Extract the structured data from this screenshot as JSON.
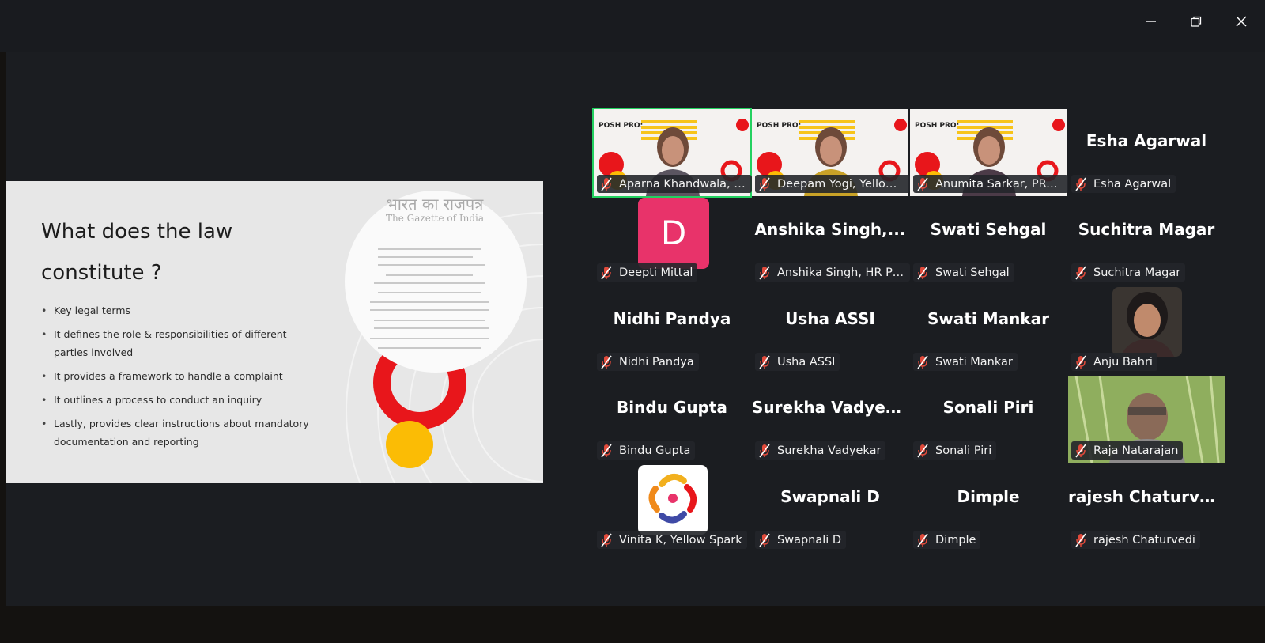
{
  "window": {
    "controls": [
      "minimize-icon",
      "restore-icon",
      "close-icon"
    ]
  },
  "slide": {
    "title_line1": "What does the law",
    "title_line2": "constitute ?",
    "bullets": [
      "Key legal terms",
      "It defines the role & responsibilities of different parties involved",
      "It provides a framework to handle a complaint",
      "It outlines a process to conduct an inquiry",
      "Lastly, provides clear instructions about mandatory documentation and reporting"
    ],
    "gazette_line1": "भारत का राजपत्र",
    "gazette_line2": "The Gazette of India",
    "colors": {
      "accent_red": "#e8161b",
      "accent_yellow": "#fbbc05"
    }
  },
  "participants": [
    {
      "big": "",
      "label": "Aparna Khandwala, Yello...",
      "video": true,
      "active_speaker": true,
      "banner": "POSH PRO:"
    },
    {
      "big": "",
      "label": "Deepam Yogi, Yellow S...",
      "video": true,
      "banner": "POSH PRO:"
    },
    {
      "big": "",
      "label": "Anumita Sarkar, PRAB...",
      "video": true,
      "banner": "POSH PRO:"
    },
    {
      "big": "Esha Agarwal",
      "label": "Esha Agarwal"
    },
    {
      "big": "",
      "label": "Deepti Mittal",
      "avatar_letter": "D"
    },
    {
      "big": "Anshika  Singh,...",
      "label": "Anshika Singh, HR Pra..."
    },
    {
      "big": "Swati Sehgal",
      "label": "Swati Sehgal"
    },
    {
      "big": "Suchitra Magar",
      "label": "Suchitra Magar"
    },
    {
      "big": "Nidhi Pandya",
      "label": "Nidhi Pandya"
    },
    {
      "big": "Usha ASSI",
      "label": "Usha ASSI"
    },
    {
      "big": "Swati Mankar",
      "label": "Swati Mankar"
    },
    {
      "big": "",
      "label": "Anju Bahri",
      "photo": true
    },
    {
      "big": "Bindu Gupta",
      "label": "Bindu Gupta"
    },
    {
      "big": "Surekha Vadyekar",
      "label": "Surekha Vadyekar"
    },
    {
      "big": "Sonali Piri",
      "label": "Sonali Piri"
    },
    {
      "big": "",
      "label": "Raja Natarajan",
      "video": true
    },
    {
      "big": "",
      "label": "Vinita K, Yellow Spark",
      "logo": true
    },
    {
      "big": "Swapnali D",
      "label": "Swapnali D"
    },
    {
      "big": "Dimple",
      "label": "Dimple"
    },
    {
      "big": "rajesh Chaturvedi",
      "label": "rajesh Chaturvedi"
    }
  ]
}
